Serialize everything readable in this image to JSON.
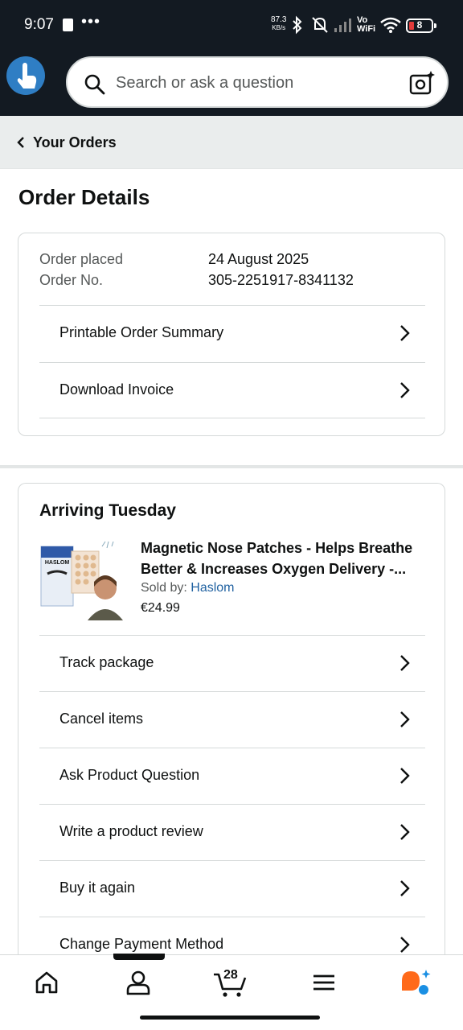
{
  "status_bar": {
    "time": "9:07",
    "more": "•••",
    "speed_value": "87.3",
    "speed_unit": "KB/s",
    "vo": "Vo",
    "wifi": "WiFi",
    "battery": "8"
  },
  "search": {
    "placeholder": "Search or ask a question"
  },
  "breadcrumb": {
    "label": "Your Orders"
  },
  "page_title": "Order Details",
  "order_info": {
    "placed_label": "Order placed",
    "placed_value": "24 August 2025",
    "number_label": "Order No.",
    "number_value": "305-2251917-8341132",
    "links": [
      {
        "label": "Printable Order Summary"
      },
      {
        "label": "Download Invoice"
      }
    ]
  },
  "shipment": {
    "heading": "Arriving Tuesday",
    "product": {
      "title": "Magnetic Nose Patches - Helps Breathe Better & Increases Oxygen Delivery -...",
      "sold_by_label": "Sold by: ",
      "seller": "Haslom",
      "price": "€24.99",
      "image_brand": "HASLOM"
    },
    "actions": [
      {
        "label": "Track package"
      },
      {
        "label": "Cancel items"
      },
      {
        "label": "Ask Product Question"
      },
      {
        "label": "Write a product review"
      },
      {
        "label": "Buy it again"
      },
      {
        "label": "Change Payment Method"
      }
    ]
  },
  "bottom_nav": {
    "cart_count": "28",
    "items": [
      "home-icon",
      "account-icon",
      "cart-icon",
      "menu-icon",
      "assistant-icon"
    ]
  },
  "colors": {
    "header_bg": "#131a22",
    "link": "#2162a1",
    "assistant_orange": "#ff6a1a",
    "assistant_blue": "#1a8fe3"
  }
}
